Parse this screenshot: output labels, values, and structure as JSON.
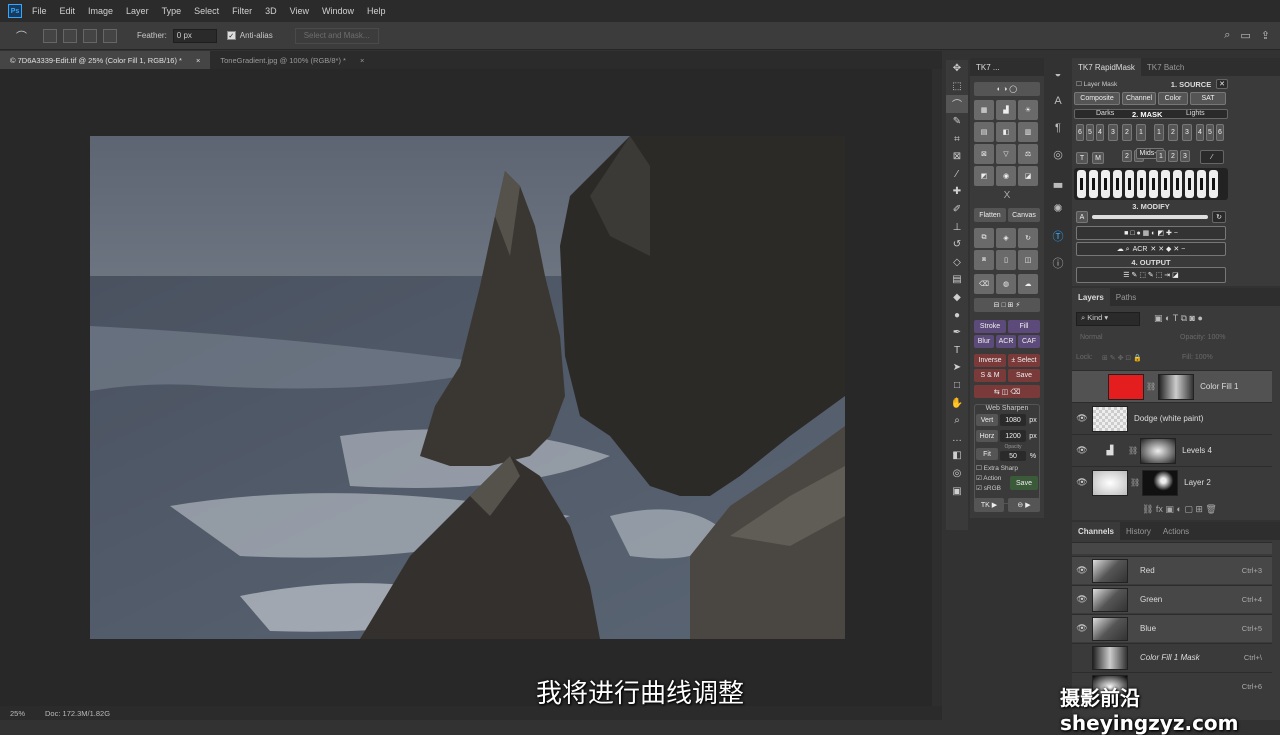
{
  "app": {
    "logo": "Ps"
  },
  "menu": [
    "File",
    "Edit",
    "Image",
    "Layer",
    "Type",
    "Select",
    "Filter",
    "3D",
    "View",
    "Window",
    "Help"
  ],
  "options": {
    "feather_label": "Feather:",
    "feather_value": "0 px",
    "antialias_label": "Anti-alias",
    "antialias_checked": true,
    "select_mask_label": "Select and Mask..."
  },
  "doc_tabs": [
    {
      "label": "© 7D6A3339-Edit.tif @ 25% (Color Fill 1, RGB/16) *",
      "close": "×"
    },
    {
      "label": "ToneGradient.jpg @ 100% (RGB/8*) *",
      "close": "×"
    }
  ],
  "status": {
    "zoom": "25%",
    "doc": "Doc: 172.3M/1.82G"
  },
  "tk7": {
    "tab": "TK7 ...",
    "flatten": "Flatten",
    "canvas": "Canvas",
    "stroke": "Stroke",
    "fill": "Fill",
    "blur": "Blur",
    "acr": "ACR",
    "caf": "CAF",
    "inverse": "Inverse",
    "select": "± Select",
    "sm": "S & M",
    "save": "Save",
    "websharpen": "Web Sharpen",
    "vert": "Vert",
    "vert_val": "1080",
    "horz": "Horz",
    "horz_val": "1200",
    "px": "px",
    "fit": "Fit",
    "opacity_label": "Opacity",
    "opacity_val": "50",
    "pct": "%",
    "extra_sharp": "Extra Sharp",
    "action": "Action",
    "srgb": "sRGB",
    "save2": "Save",
    "tk": "TK ▶",
    "bottom_btn": "⊖ ▶",
    "x_label": "X"
  },
  "rapidmask": {
    "tabs": [
      "TK7 RapidMask",
      "TK7 Batch"
    ],
    "layer_mask": "Layer Mask",
    "source_title": "1. SOURCE",
    "source_btns": [
      "Composite",
      "Channel",
      "Color",
      "SAT"
    ],
    "mask_title": "2. MASK",
    "darks": "Darks",
    "lights": "Lights",
    "mids": "Mids-1",
    "dark_nums": [
      "6",
      "5",
      "4",
      "3",
      "2",
      "1"
    ],
    "light_nums": [
      "1",
      "2",
      "3",
      "4",
      "5",
      "6"
    ],
    "mid_nums": [
      "2",
      "1",
      "1",
      "2",
      "3"
    ],
    "t": "T",
    "m": "M",
    "modify_title": "3. MODIFY",
    "a": "A",
    "acr": "ACR",
    "output_title": "4. OUTPUT"
  },
  "layers": {
    "tabs": [
      "Layers",
      "Paths"
    ],
    "kind": "Kind",
    "blend": "Normal",
    "opacity": "Opacity: 100%",
    "lock": "Lock:",
    "fill": "Fill: 100%",
    "items": [
      {
        "name": "Color Fill 1",
        "visible": false
      },
      {
        "name": "Dodge (white paint)",
        "visible": true
      },
      {
        "name": "Levels 4",
        "visible": true
      },
      {
        "name": "Layer 2",
        "visible": true
      }
    ]
  },
  "channels": {
    "tabs": [
      "Channels",
      "History",
      "Actions"
    ],
    "items": [
      {
        "name": "Red",
        "key": "Ctrl+3"
      },
      {
        "name": "Green",
        "key": "Ctrl+4"
      },
      {
        "name": "Blue",
        "key": "Ctrl+5"
      },
      {
        "name": "Color Fill 1 Mask",
        "key": "Ctrl+\\"
      },
      {
        "name": "",
        "key": "Ctrl+6"
      }
    ]
  },
  "subtitle": "我将进行曲线调整",
  "watermark": "摄影前沿 sheyingzyz.com",
  "colors": {
    "accent": "#31a8ff",
    "fill_red": "#e41e1e",
    "purple": "#5c4a7a"
  }
}
